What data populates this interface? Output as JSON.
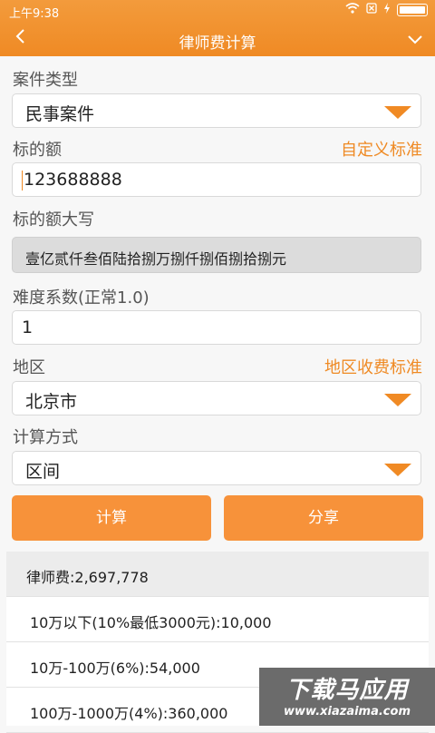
{
  "status_bar": {
    "time": "上午9:38"
  },
  "header": {
    "title": "律师费计算"
  },
  "case_type": {
    "label": "案件类型",
    "value": "民事案件"
  },
  "amount": {
    "label": "标的额",
    "link": "自定义标准",
    "value": "123688888"
  },
  "amount_upper": {
    "label": "标的额大写",
    "value": "壹亿贰仟叁佰陆拾捌万捌仟捌佰捌拾捌元"
  },
  "difficulty": {
    "label": "难度系数(正常1.0)",
    "value": "1"
  },
  "region": {
    "label": "地区",
    "link": "地区收费标准",
    "value": "北京市"
  },
  "method": {
    "label": "计算方式",
    "value": "区间"
  },
  "buttons": {
    "calculate": "计算",
    "share": "分享"
  },
  "results": {
    "total": "律师费:2,697,778",
    "rows": [
      "10万以下(10%最低3000元):10,000",
      "10万-100万(6%):54,000",
      "100万-1000万(4%):360,000"
    ]
  },
  "watermark": {
    "title": "下载马应用",
    "subtitle": "www.xiazaima.com"
  },
  "colors": {
    "accent": "#ef8a24",
    "button": "#f7923a"
  }
}
